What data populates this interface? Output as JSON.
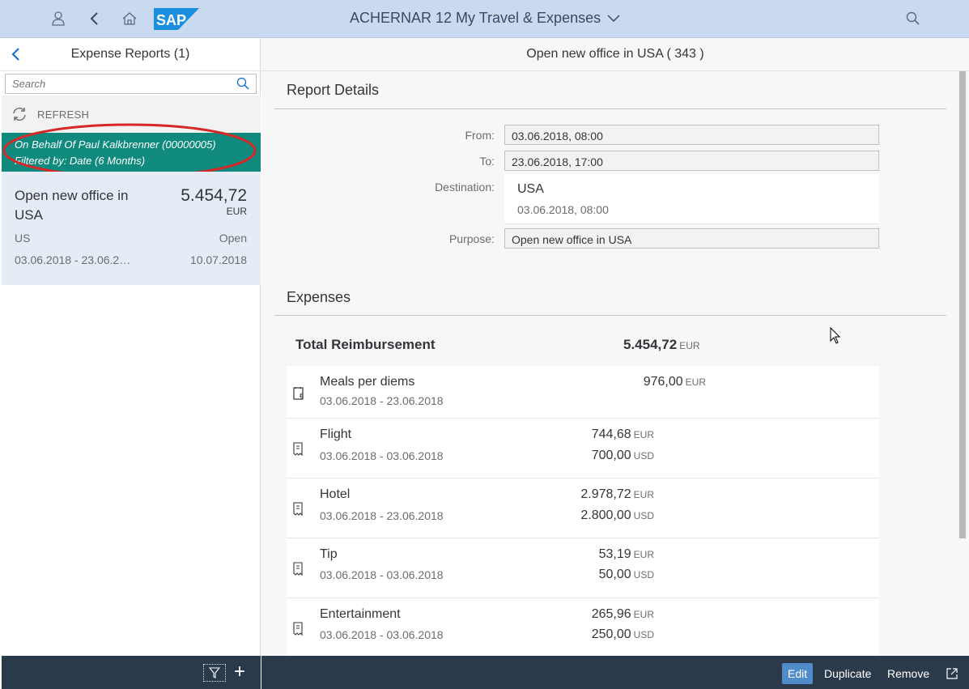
{
  "shell": {
    "title": "ACHERNAR 12 My Travel & Expenses",
    "logo_text": "SAP"
  },
  "master": {
    "title": "Expense Reports (1)",
    "search_placeholder": "Search",
    "refresh_label": "REFRESH",
    "info_line1": "On Behalf Of Paul Kalkbrenner (00000005)",
    "info_line2": "Filtered by: Date (6 Months)",
    "item": {
      "name": "Open new office in USA",
      "amount": "5.454,72",
      "currency": "EUR",
      "country": "US",
      "status": "Open",
      "dates": "03.06.2018 - 23.06.2…",
      "created": "10.07.2018"
    }
  },
  "detail": {
    "header": "Open new office in USA ( 343 )",
    "report_details_title": "Report Details",
    "from_label": "From:",
    "from_value": "03.06.2018, 08:00",
    "to_label": "To:",
    "to_value": "23.06.2018, 17:00",
    "destination_label": "Destination:",
    "destination_value": "USA",
    "destination_date": "03.06.2018, 08:00",
    "purpose_label": "Purpose:",
    "purpose_value": "Open new office in USA",
    "expenses_title": "Expenses",
    "total_label": "Total Reimbursement",
    "total_value": "5.454,72",
    "total_currency": "EUR",
    "expenses": [
      {
        "name": "Meals per diems",
        "dates": "03.06.2018 - 23.06.2018",
        "amount1": "976,00",
        "cur1": "EUR"
      },
      {
        "name": "Flight",
        "dates": "03.06.2018 - 03.06.2018",
        "amount1": "744,68",
        "cur1": "EUR",
        "amount2": "700,00",
        "cur2": "USD"
      },
      {
        "name": "Hotel",
        "dates": "03.06.2018 - 23.06.2018",
        "amount1": "2.978,72",
        "cur1": "EUR",
        "amount2": "2.800,00",
        "cur2": "USD"
      },
      {
        "name": "Tip",
        "dates": "03.06.2018 - 03.06.2018",
        "amount1": "53,19",
        "cur1": "EUR",
        "amount2": "50,00",
        "cur2": "USD"
      },
      {
        "name": "Entertainment",
        "dates": "03.06.2018 - 03.06.2018",
        "amount1": "265,96",
        "cur1": "EUR",
        "amount2": "250,00",
        "cur2": "USD"
      }
    ]
  },
  "footer": {
    "edit_label": "Edit",
    "duplicate_label": "Duplicate",
    "remove_label": "Remove"
  },
  "colors": {
    "shell_bg": "#c9daf0",
    "info_bar": "#118a7e",
    "selected_item": "#e5ecf6",
    "footer_bg": "#2b3a4b",
    "edit_button": "#4f8cc9",
    "highlight_ellipse": "#d62828"
  }
}
